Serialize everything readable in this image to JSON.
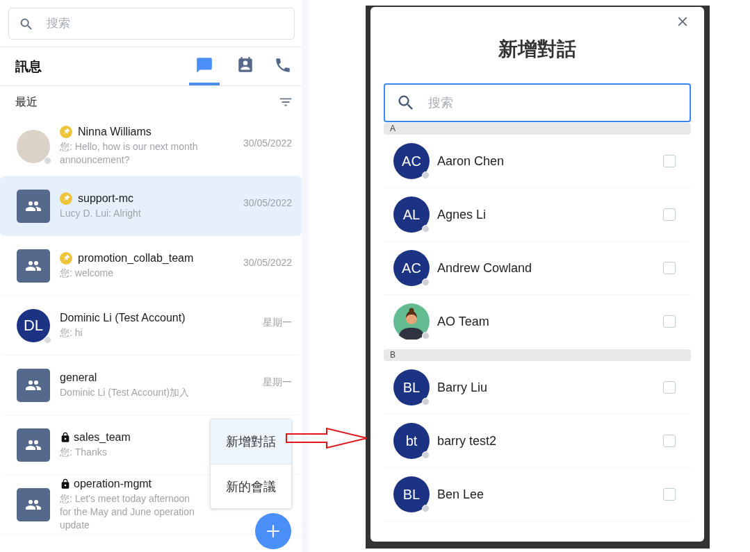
{
  "sidebar": {
    "search": {
      "placeholder": "搜索"
    },
    "title": "訊息",
    "tabs": [
      {
        "kind": "chat",
        "selected": true
      },
      {
        "kind": "contacts",
        "selected": false
      },
      {
        "kind": "phone",
        "selected": false
      }
    ],
    "section_label": "最近",
    "conversations": [
      {
        "kind": "photo",
        "name": "Ninna Williams",
        "pinned": true,
        "locked": false,
        "preview": "您: Hello, how is our next month announcement?",
        "time": "30/05/2022",
        "selected": false
      },
      {
        "kind": "group",
        "name": "support-mc",
        "pinned": true,
        "locked": false,
        "preview": "Lucy D. Lui: Alright",
        "time": "30/05/2022",
        "selected": true
      },
      {
        "kind": "group",
        "name": "promotion_collab_team",
        "pinned": true,
        "locked": false,
        "preview": "您: welcome",
        "time": "30/05/2022",
        "selected": false
      },
      {
        "kind": "initials",
        "initials": "DL",
        "name": "Dominic Li (Test Account)",
        "pinned": false,
        "locked": false,
        "preview": "您: hi",
        "time": "星期一",
        "selected": false
      },
      {
        "kind": "group",
        "name": "general",
        "pinned": false,
        "locked": false,
        "preview": "Dominic Li (Test Account)加入",
        "time": "星期一",
        "selected": false
      },
      {
        "kind": "group",
        "name": "sales_team",
        "pinned": false,
        "locked": true,
        "preview": "您: Thanks",
        "selected": false
      },
      {
        "kind": "group",
        "name": "operation-mgmt",
        "pinned": false,
        "locked": true,
        "preview": "您: Let's meet today afternoon for the May and June operation update",
        "selected": false
      }
    ],
    "menu": [
      {
        "label": "新增對話",
        "selected": true
      },
      {
        "label": "新的會議",
        "selected": false
      }
    ]
  },
  "dialog": {
    "title": "新增對話",
    "search": {
      "placeholder": "搜索"
    },
    "sections": [
      {
        "letter": "A",
        "contacts": [
          {
            "kind": "initials",
            "initials": "AC",
            "name": "Aaron Chen",
            "checked": false
          },
          {
            "kind": "initials",
            "initials": "AL",
            "name": "Agnes Li",
            "checked": false
          },
          {
            "kind": "initials",
            "initials": "AC",
            "name": "Andrew Cowland",
            "checked": false
          },
          {
            "kind": "illustration",
            "name": "AO Team",
            "checked": false
          }
        ]
      },
      {
        "letter": "B",
        "contacts": [
          {
            "kind": "initials",
            "initials": "BL",
            "name": "Barry Liu",
            "checked": false
          },
          {
            "kind": "initials",
            "initials": "bt",
            "name": "barry test2",
            "checked": false
          },
          {
            "kind": "initials",
            "initials": "BL",
            "name": "Ben Lee",
            "checked": false
          }
        ]
      }
    ]
  }
}
